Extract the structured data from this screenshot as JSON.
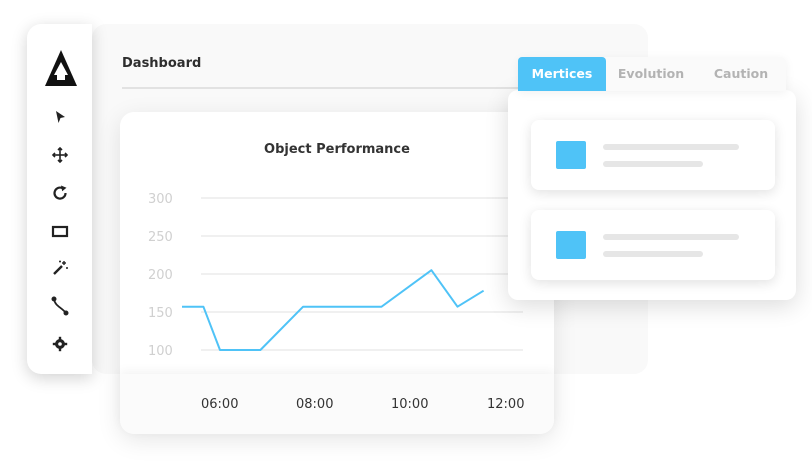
{
  "dashboard": {
    "title": "Dashboard"
  },
  "toolbar": {
    "logo_icon": "logo-triangle-icon",
    "tools": [
      {
        "name": "select-arrow-icon"
      },
      {
        "name": "move-icon"
      },
      {
        "name": "rotate-icon"
      },
      {
        "name": "rectangle-icon"
      },
      {
        "name": "magic-wand-icon"
      },
      {
        "name": "curve-icon"
      },
      {
        "name": "settings-gear-icon"
      }
    ]
  },
  "tabs": [
    {
      "label": "Mertices",
      "active": true
    },
    {
      "label": "Evolution",
      "active": false
    },
    {
      "label": "Caution",
      "active": false
    }
  ],
  "metrics": {
    "accent_color": "#4fc3f7",
    "cards": [
      {
        "icon": "blue-square"
      },
      {
        "icon": "blue-square"
      }
    ]
  },
  "colors": {
    "accent": "#4fc3f7",
    "text": "#333333",
    "tick": "#d0d0d0",
    "grid": "#e0e0e0"
  },
  "chart_data": {
    "type": "line",
    "title": "Object Performance",
    "xlabel": "",
    "ylabel": "",
    "ylim": [
      100,
      300
    ],
    "xlim": [
      5.2,
      12.0
    ],
    "yticks": [
      300,
      250,
      200,
      150,
      100
    ],
    "xticks": [
      {
        "value": 6,
        "label": "06:00"
      },
      {
        "value": 8,
        "label": "08:00"
      },
      {
        "value": 10,
        "label": "10:00"
      },
      {
        "value": 12,
        "label": "12:00"
      }
    ],
    "grid": true,
    "series": [
      {
        "color": "#4fc3f7",
        "x": [
          5.2,
          5.65,
          6.0,
          6.85,
          7.75,
          9.4,
          10.45,
          11.0,
          11.55
        ],
        "y": [
          157,
          157,
          100,
          100,
          157,
          157,
          205,
          157,
          178
        ]
      }
    ]
  }
}
